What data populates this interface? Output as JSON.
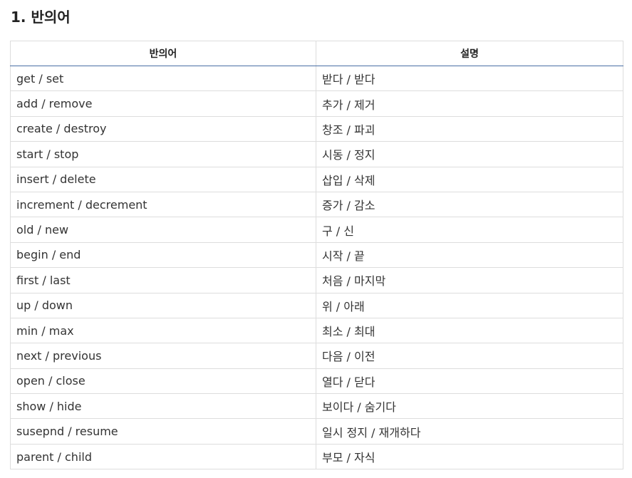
{
  "heading": "1. 반의어",
  "table": {
    "headers": [
      "반의어",
      "설명"
    ],
    "rows": [
      {
        "term": "get / set",
        "meaning": "받다 / 받다"
      },
      {
        "term": "add / remove",
        "meaning": "추가 / 제거"
      },
      {
        "term": "create / destroy",
        "meaning": "창조 / 파괴"
      },
      {
        "term": "start / stop",
        "meaning": "시동 / 정지"
      },
      {
        "term": "insert / delete",
        "meaning": "삽입 / 삭제"
      },
      {
        "term": "increment / decrement",
        "meaning": "증가 / 감소"
      },
      {
        "term": "old / new",
        "meaning": "구 / 신"
      },
      {
        "term": "begin / end",
        "meaning": "시작 / 끝"
      },
      {
        "term": "first / last",
        "meaning": "처음 / 마지막"
      },
      {
        "term": "up / down",
        "meaning": "위 / 아래"
      },
      {
        "term": "min / max",
        "meaning": "최소 / 최대"
      },
      {
        "term": "next / previous",
        "meaning": "다음 / 이전"
      },
      {
        "term": "open / close",
        "meaning": "열다 / 닫다"
      },
      {
        "term": "show / hide",
        "meaning": "보이다 / 숨기다"
      },
      {
        "term": "susepnd / resume",
        "meaning": "일시 정지 / 재개하다"
      },
      {
        "term": "parent / child",
        "meaning": "부모 / 자식"
      }
    ]
  },
  "colors": {
    "header_underline": "#4a6fa5",
    "grid": "#dddddd"
  }
}
